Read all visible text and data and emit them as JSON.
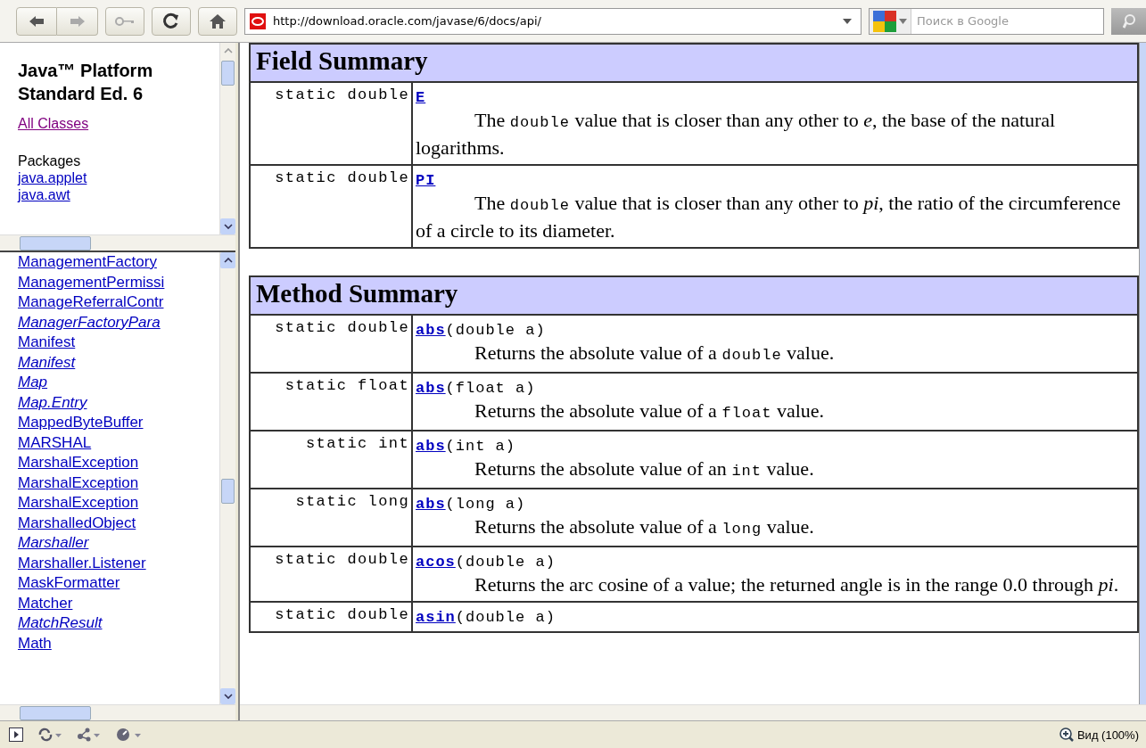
{
  "toolbar": {
    "url": "http://download.oracle.com/javase/6/docs/api/",
    "search": {
      "placeholder": "Поиск в Google"
    }
  },
  "packages_frame": {
    "title": "Java™ Platform Standard Ed. 6",
    "all_classes": "All Classes",
    "heading": "Packages",
    "packages": [
      "java.applet",
      "java.awt"
    ]
  },
  "classes_frame": {
    "classes": [
      {
        "name": "ManagementFactory",
        "italic": false
      },
      {
        "name": "ManagementPermissi",
        "italic": false
      },
      {
        "name": "ManageReferralContr",
        "italic": false
      },
      {
        "name": "ManagerFactoryPara",
        "italic": true
      },
      {
        "name": "Manifest",
        "italic": false
      },
      {
        "name": "Manifest",
        "italic": true
      },
      {
        "name": "Map",
        "italic": true
      },
      {
        "name": "Map.Entry",
        "italic": true
      },
      {
        "name": "MappedByteBuffer",
        "italic": false
      },
      {
        "name": "MARSHAL",
        "italic": false
      },
      {
        "name": "MarshalException",
        "italic": false
      },
      {
        "name": "MarshalException",
        "italic": false
      },
      {
        "name": "MarshalException",
        "italic": false
      },
      {
        "name": "MarshalledObject",
        "italic": false
      },
      {
        "name": "Marshaller",
        "italic": true
      },
      {
        "name": "Marshaller.Listener",
        "italic": false
      },
      {
        "name": "MaskFormatter",
        "italic": false
      },
      {
        "name": "Matcher",
        "italic": false
      },
      {
        "name": "MatchResult",
        "italic": true
      },
      {
        "name": "Math",
        "italic": false
      }
    ]
  },
  "sections": [
    {
      "title": "Field Summary",
      "rows": [
        {
          "type": "static double",
          "name": "E",
          "desc": [
            {
              "kind": "text",
              "text": "The "
            },
            {
              "kind": "code",
              "text": "double"
            },
            {
              "kind": "text",
              "text": " value that is closer than any other to "
            },
            {
              "kind": "italic",
              "text": "e"
            },
            {
              "kind": "text",
              "text": ", the base of the natural logarithms."
            }
          ]
        },
        {
          "type": "static double",
          "name": "PI",
          "desc": [
            {
              "kind": "text",
              "text": "The "
            },
            {
              "kind": "code",
              "text": "double"
            },
            {
              "kind": "text",
              "text": " value that is closer than any other to "
            },
            {
              "kind": "italic",
              "text": "pi"
            },
            {
              "kind": "text",
              "text": ", the ratio of the circumference of a circle to its diameter."
            }
          ]
        }
      ]
    },
    {
      "title": "Method Summary",
      "rows": [
        {
          "type": "static double",
          "name": "abs",
          "params": "(double a)",
          "desc": [
            {
              "kind": "text",
              "text": "Returns the absolute value of a "
            },
            {
              "kind": "code",
              "text": "double"
            },
            {
              "kind": "text",
              "text": " value."
            }
          ]
        },
        {
          "type": "static float",
          "name": "abs",
          "params": "(float a)",
          "desc": [
            {
              "kind": "text",
              "text": "Returns the absolute value of a "
            },
            {
              "kind": "code",
              "text": "float"
            },
            {
              "kind": "text",
              "text": " value."
            }
          ]
        },
        {
          "type": "static int",
          "name": "abs",
          "params": "(int a)",
          "desc": [
            {
              "kind": "text",
              "text": "Returns the absolute value of an "
            },
            {
              "kind": "code",
              "text": "int"
            },
            {
              "kind": "text",
              "text": " value."
            }
          ]
        },
        {
          "type": "static long",
          "name": "abs",
          "params": "(long a)",
          "desc": [
            {
              "kind": "text",
              "text": "Returns the absolute value of a "
            },
            {
              "kind": "code",
              "text": "long"
            },
            {
              "kind": "text",
              "text": " value."
            }
          ]
        },
        {
          "type": "static double",
          "name": "acos",
          "params": "(double a)",
          "desc": [
            {
              "kind": "text",
              "text": "Returns the arc cosine of a value; the returned angle is in the range 0.0 through "
            },
            {
              "kind": "italic",
              "text": "pi"
            },
            {
              "kind": "text",
              "text": "."
            }
          ]
        },
        {
          "type": "static double",
          "name": "asin",
          "params": "(double a)"
        }
      ]
    }
  ],
  "status_bar": {
    "zoom": "Вид (100%)"
  }
}
